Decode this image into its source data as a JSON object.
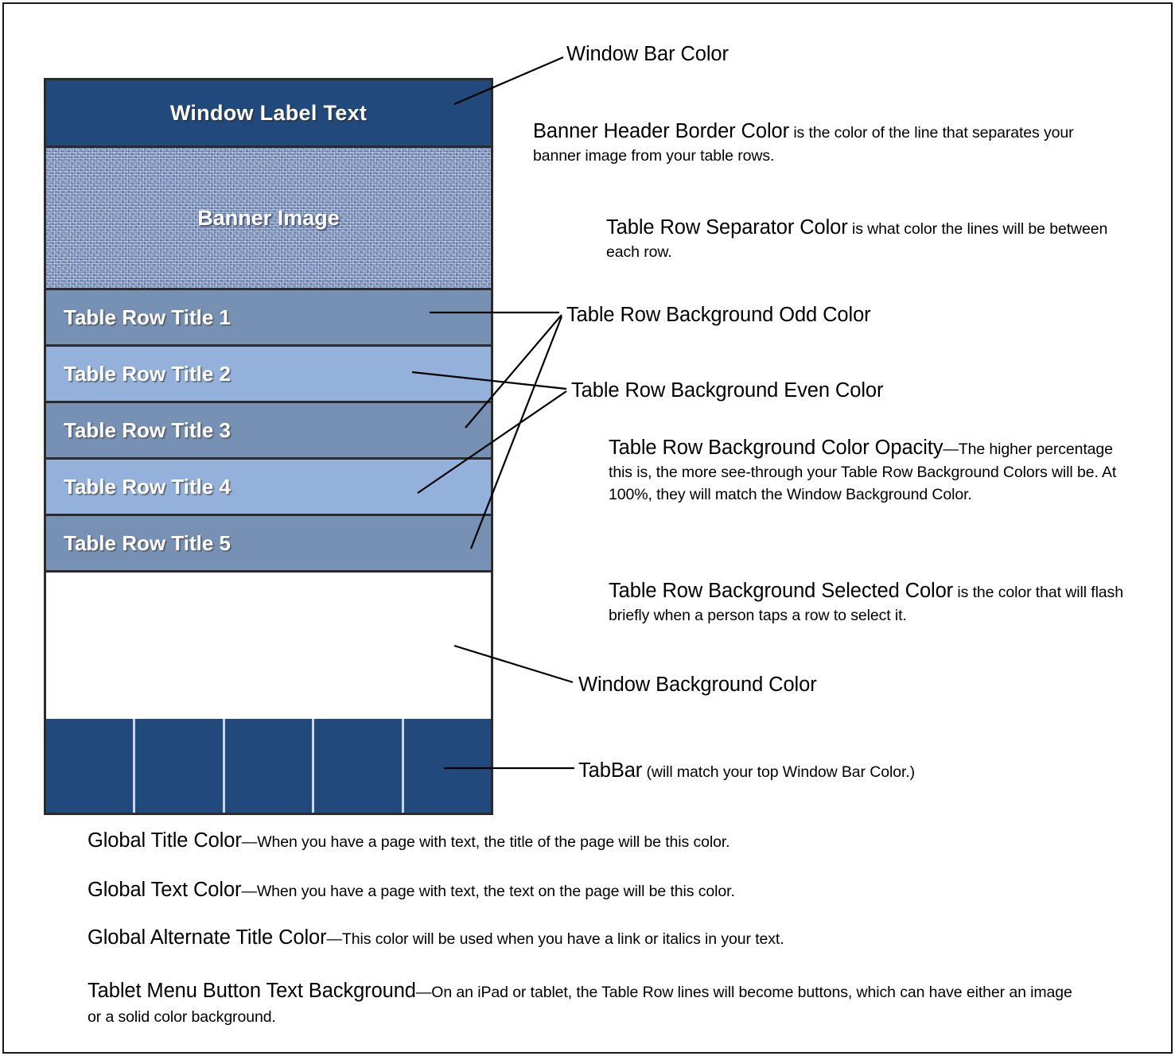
{
  "device": {
    "window_bar": {
      "label": "Window Label Text",
      "color": "#22497B"
    },
    "banner": {
      "label": "Banner Image"
    },
    "rows": [
      {
        "title": "Table Row Title 1",
        "parity": "odd"
      },
      {
        "title": "Table Row Title 2",
        "parity": "even"
      },
      {
        "title": "Table Row Title 3",
        "parity": "odd"
      },
      {
        "title": "Table Row Title 4",
        "parity": "even"
      },
      {
        "title": "Table Row Title 5",
        "parity": "odd"
      }
    ],
    "row_colors": {
      "odd": "#7791B4",
      "even": "#93B1DA"
    },
    "window_background_color": "#FFFFFF",
    "tabbar": {
      "segments": 5,
      "color": "#22497B"
    }
  },
  "annotations": {
    "window_bar_color": {
      "term": "Window Bar Color",
      "desc": ""
    },
    "banner_header_border_color": {
      "term": "Banner Header Border Color",
      "desc": " is the color of the line that separates your banner image from your table rows."
    },
    "table_row_separator_color": {
      "term": "Table Row Separator Color",
      "desc": " is what color the lines will be between each row."
    },
    "table_row_background_odd_color": {
      "term": "Table Row Background Odd Color",
      "desc": ""
    },
    "table_row_background_even_color": {
      "term": "Table Row Background Even Color",
      "desc": ""
    },
    "table_row_background_color_opacity": {
      "term": "Table Row Background Color Opacity",
      "desc": "—The higher percentage this is, the more see-through your Table Row Background Colors will be. At 100%, they will match the Window Background Color."
    },
    "table_row_background_selected_color": {
      "term": "Table Row Background Selected Color",
      "desc": " is the color that will flash briefly when a person taps a row to select it."
    },
    "window_background_color": {
      "term": "Window Background Color",
      "desc": ""
    },
    "tabbar": {
      "term": "TabBar",
      "desc": " (will match your top Window Bar Color.)"
    }
  },
  "bottom_notes": [
    {
      "term": "Global Title Color",
      "desc": "—When you have a page with text, the title of the page will be this color."
    },
    {
      "term": "Global Text Color",
      "desc": "—When you have a page with text, the text on the page will be this color."
    },
    {
      "term": "Global Alternate Title Color",
      "desc": "—This color will be used when you have a link  or italics in your text."
    },
    {
      "term": "Tablet Menu Button Text Background",
      "desc": "—On an iPad or tablet, the Table Row lines will become buttons, which can have either an image or a solid color background."
    }
  ]
}
